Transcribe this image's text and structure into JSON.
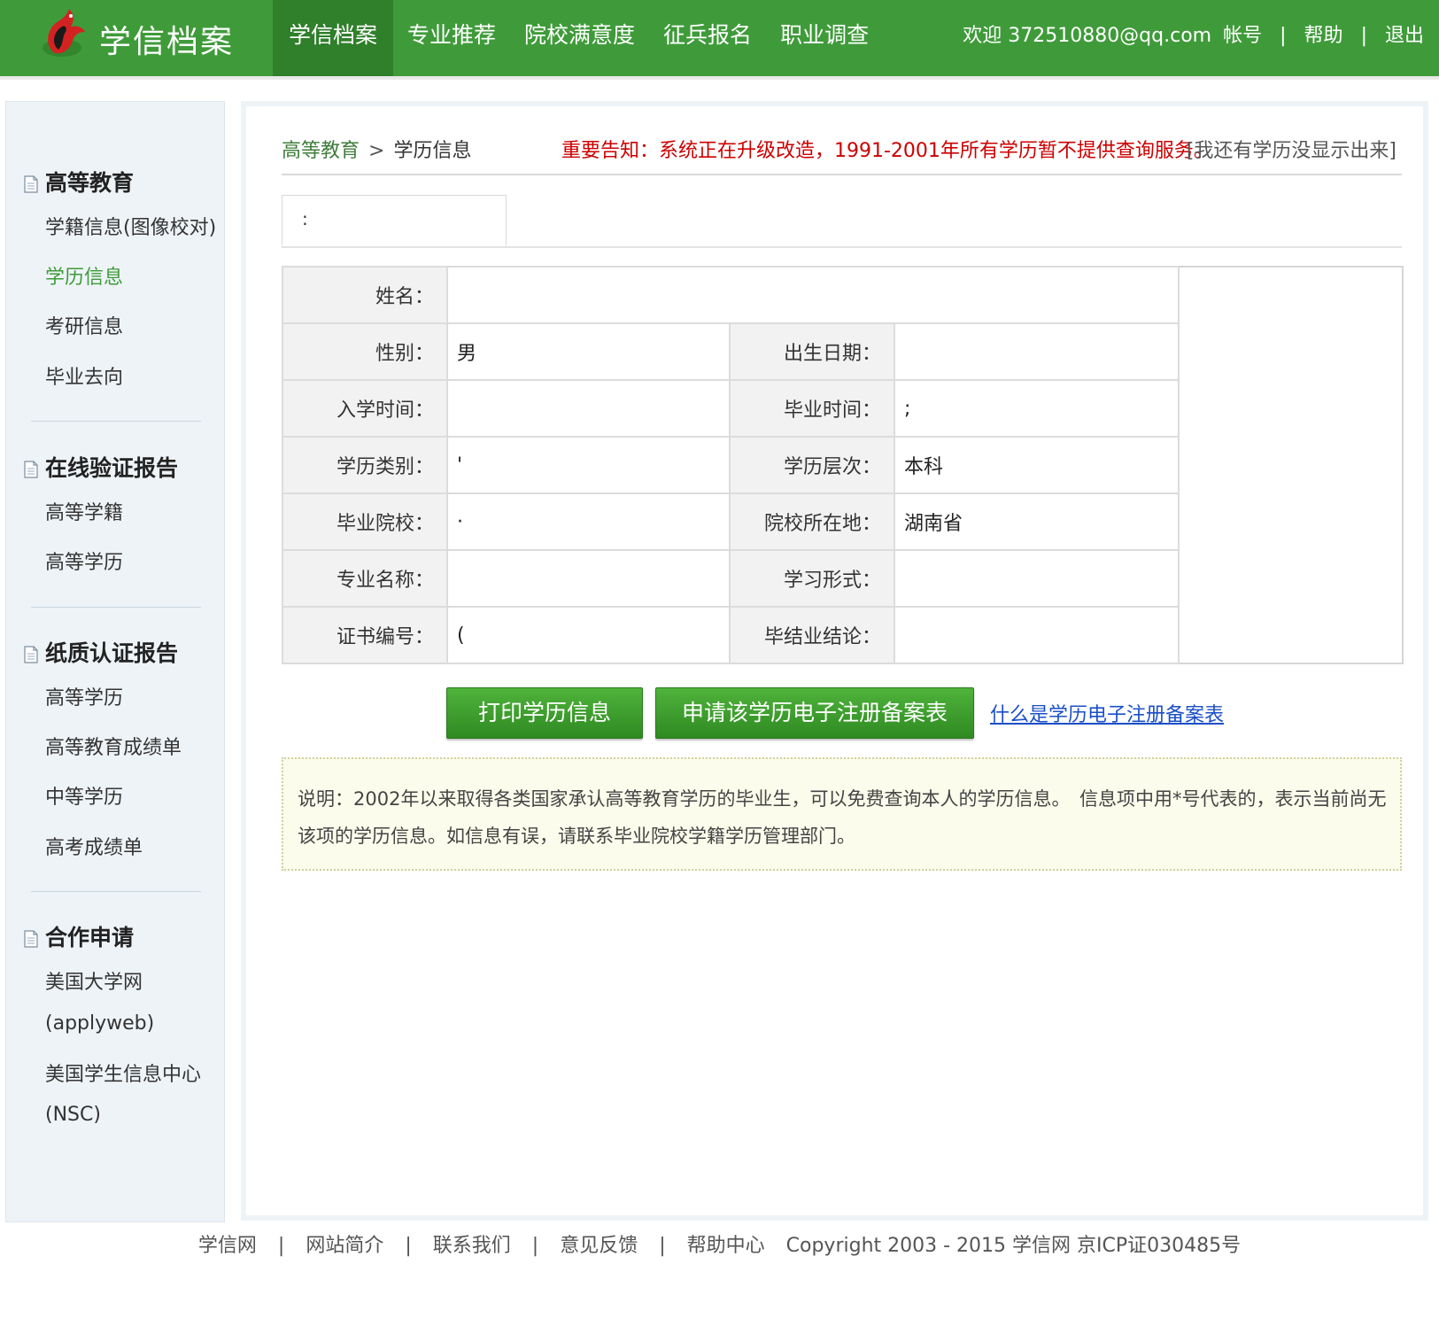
{
  "header": {
    "site_name": "学信档案",
    "nav": [
      {
        "label": "学信档案",
        "active": true
      },
      {
        "label": "专业推荐",
        "active": false
      },
      {
        "label": "院校满意度",
        "active": false
      },
      {
        "label": "征兵报名",
        "active": false
      },
      {
        "label": "职业调查",
        "active": false
      }
    ],
    "welcome": "欢迎 372510880@qq.com",
    "account_label": "帐号",
    "help_label": "帮助",
    "logout_label": "退出",
    "separator": "|"
  },
  "sidebar": {
    "groups": [
      {
        "title": "高等教育",
        "items": [
          "学籍信息(图像校对)",
          "学历信息",
          "考研信息",
          "毕业去向"
        ]
      },
      {
        "title": "在线验证报告",
        "items": [
          "高等学籍",
          "高等学历"
        ]
      },
      {
        "title": "纸质认证报告",
        "items": [
          "高等学历",
          "高等教育成绩单",
          "中等学历",
          "高考成绩单"
        ]
      },
      {
        "title": "合作申请",
        "items": [
          "美国大学网",
          "(applyweb)",
          "美国学生信息中心",
          "(NSC)"
        ]
      }
    ],
    "active_item": "学历信息"
  },
  "main": {
    "breadcrumb": {
      "parent": "高等教育",
      "arrow": ">",
      "current": "学历信息"
    },
    "notice": "重要告知：系统正在升级改造，1991-2001年所有学历暂不提供查询服务。",
    "missing_link": "[我还有学历没显示出来]",
    "tab_label": ":",
    "fields": {
      "name": {
        "label": "姓名：",
        "value": ""
      },
      "gender": {
        "label": "性别：",
        "value": "男"
      },
      "birth": {
        "label": "出生日期：",
        "value": ""
      },
      "enroll": {
        "label": "入学时间：",
        "value": ""
      },
      "graduate": {
        "label": "毕业时间：",
        "value": ";"
      },
      "edu_type": {
        "label": "学历类别：",
        "value": "'"
      },
      "edu_level": {
        "label": "学历层次：",
        "value": "本科"
      },
      "school": {
        "label": "毕业院校：",
        "value": "·"
      },
      "school_location": {
        "label": "院校所在地：",
        "value": "湖南省"
      },
      "major": {
        "label": "专业名称：",
        "value": ""
      },
      "study_form": {
        "label": "学习形式：",
        "value": ""
      },
      "cert_no": {
        "label": "证书编号：",
        "value": "("
      },
      "conclusion": {
        "label": "毕结业结论：",
        "value": ""
      }
    },
    "buttons": {
      "print": "打印学历信息",
      "apply": "申请该学历电子注册备案表",
      "what_is": "什么是学历电子注册备案表"
    },
    "note": "说明：2002年以来取得各类国家承认高等教育学历的毕业生，可以免费查询本人的学历信息。　信息项中用*号代表的，表示当前尚无该项的学历信息。如信息有误，请联系毕业院校学籍学历管理部门。"
  },
  "footer": {
    "links": [
      "学信网",
      "网站简介",
      "联系我们",
      "意见反馈",
      "帮助中心"
    ],
    "separator": "|",
    "copyright": "Copyright 2003 - 2015  学信网  京ICP证030485号"
  },
  "colors": {
    "brand_green": "#3f9b3a",
    "notice_red": "#cc0000",
    "link_blue": "#1b4fc7",
    "sidebar_bg": "#eef3f7"
  },
  "icons": {
    "logo": "bird-logo-icon",
    "doc": "document-icon"
  }
}
